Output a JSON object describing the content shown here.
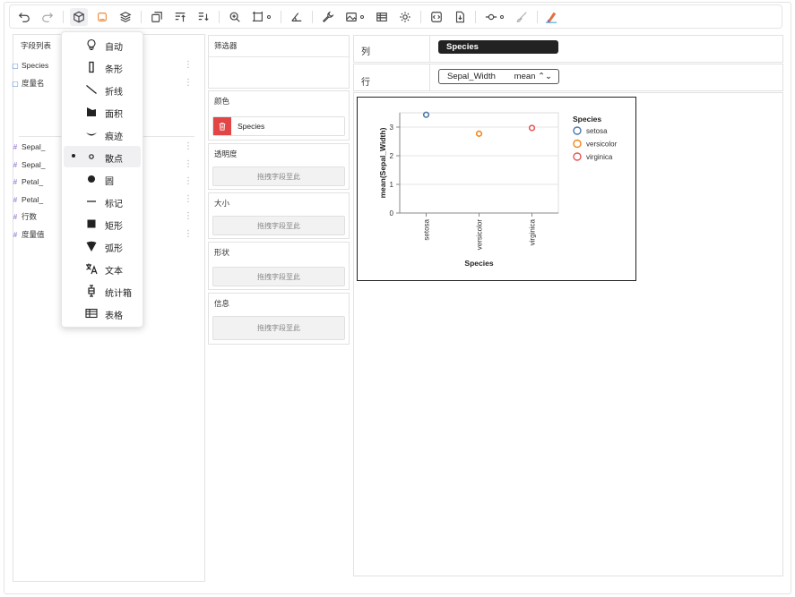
{
  "toolbar": {
    "buttons": [
      "undo-icon",
      "redo-icon",
      "mark-cube-icon",
      "layout-icon",
      "layers-icon",
      "transpose-icon",
      "sort-asc-icon",
      "sort-desc-icon",
      "zoom-icon",
      "size-mode-icon",
      "axis-icon",
      "wrench-icon",
      "image-icon",
      "table-icon",
      "settings-icon",
      "code-icon",
      "export-icon",
      "connector-icon",
      "brush-icon",
      "paint-icon"
    ]
  },
  "fields": {
    "title": "字段列表",
    "dimensions": [
      {
        "name": "Species"
      },
      {
        "name": "度量名"
      }
    ],
    "measures": [
      {
        "name": "Sepal_"
      },
      {
        "name": "Sepal_"
      },
      {
        "name": "Petal_"
      },
      {
        "name": "Petal_"
      },
      {
        "name": "行数"
      },
      {
        "name": "度量值"
      }
    ]
  },
  "mark_menu": {
    "items": [
      {
        "label": "自动",
        "icon": "bulb-icon"
      },
      {
        "label": "条形",
        "icon": "bar-icon"
      },
      {
        "label": "折线",
        "icon": "line-icon"
      },
      {
        "label": "面积",
        "icon": "area-icon"
      },
      {
        "label": "痕迹",
        "icon": "trail-icon"
      },
      {
        "label": "散点",
        "icon": "point-icon"
      },
      {
        "label": "圆",
        "icon": "circle-icon"
      },
      {
        "label": "标记",
        "icon": "tick-icon"
      },
      {
        "label": "矩形",
        "icon": "rect-icon"
      },
      {
        "label": "弧形",
        "icon": "arc-icon"
      },
      {
        "label": "文本",
        "icon": "text-icon"
      },
      {
        "label": "统计箱",
        "icon": "boxplot-icon"
      },
      {
        "label": "表格",
        "icon": "table-icon"
      }
    ],
    "selected": "散点"
  },
  "shelves": {
    "filter": {
      "label": "筛选器"
    },
    "color": {
      "label": "颜色",
      "field": "Species"
    },
    "opacity": {
      "label": "透明度",
      "placeholder": "拖拽字段至此"
    },
    "size": {
      "label": "大小",
      "placeholder": "拖拽字段至此"
    },
    "shape": {
      "label": "形状",
      "placeholder": "拖拽字段至此"
    },
    "details": {
      "label": "信息",
      "placeholder": "拖拽字段至此"
    }
  },
  "encodings": {
    "columns": {
      "label": "列",
      "field": "Species"
    },
    "rows": {
      "label": "行",
      "field": "Sepal_Width",
      "aggregate": "mean ⌃⌄"
    }
  },
  "chart_data": {
    "type": "scatter",
    "categories": [
      "setosa",
      "versicolor",
      "virginica"
    ],
    "series": [
      {
        "name": "setosa",
        "category": "setosa",
        "value": 3.43,
        "color": "#4c78a8"
      },
      {
        "name": "versicolor",
        "category": "versicolor",
        "value": 2.77,
        "color": "#f58518"
      },
      {
        "name": "virginica",
        "category": "virginica",
        "value": 2.97,
        "color": "#e45756"
      }
    ],
    "xlabel": "Species",
    "ylabel": "mean(Sepal_Width)",
    "ylim": [
      0,
      3.5
    ],
    "yticks": [
      "0",
      "1",
      "2",
      "3"
    ],
    "legend_title": "Species",
    "legend_placement": "right",
    "grid": true
  }
}
